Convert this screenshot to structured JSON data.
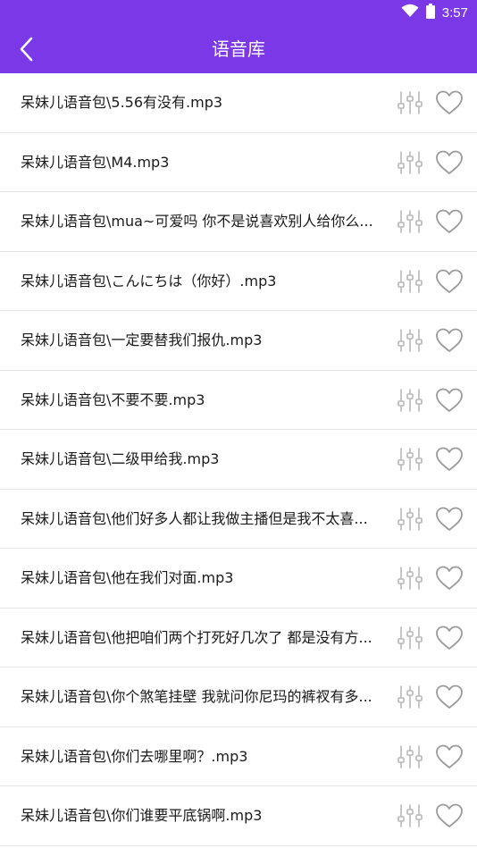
{
  "status": {
    "time": "3:57"
  },
  "header": {
    "title": "语音库"
  },
  "colors": {
    "accent": "#7b38e6",
    "icon_gray": "#b8b8b8",
    "heart_gray": "#9a9a9a"
  },
  "items": [
    {
      "name": "呆妹儿语音包\\5.56有没有.mp3"
    },
    {
      "name": "呆妹儿语音包\\M4.mp3"
    },
    {
      "name": "呆妹儿语音包\\mua~可爱吗 你不是说喜欢别人给你么..."
    },
    {
      "name": "呆妹儿语音包\\こんにちは（你好）.mp3"
    },
    {
      "name": "呆妹儿语音包\\一定要替我们报仇.mp3"
    },
    {
      "name": "呆妹儿语音包\\不要不要.mp3"
    },
    {
      "name": "呆妹儿语音包\\二级甲给我.mp3"
    },
    {
      "name": "呆妹儿语音包\\他们好多人都让我做主播但是我不太喜..."
    },
    {
      "name": "呆妹儿语音包\\他在我们对面.mp3"
    },
    {
      "name": "呆妹儿语音包\\他把咱们两个打死好几次了 都是没有方..."
    },
    {
      "name": "呆妹儿语音包\\你个煞笔挂壁 我就问你尼玛的裤衩有多..."
    },
    {
      "name": "呆妹儿语音包\\你们去哪里啊？.mp3"
    },
    {
      "name": "呆妹儿语音包\\你们谁要平底锅啊.mp3"
    }
  ]
}
